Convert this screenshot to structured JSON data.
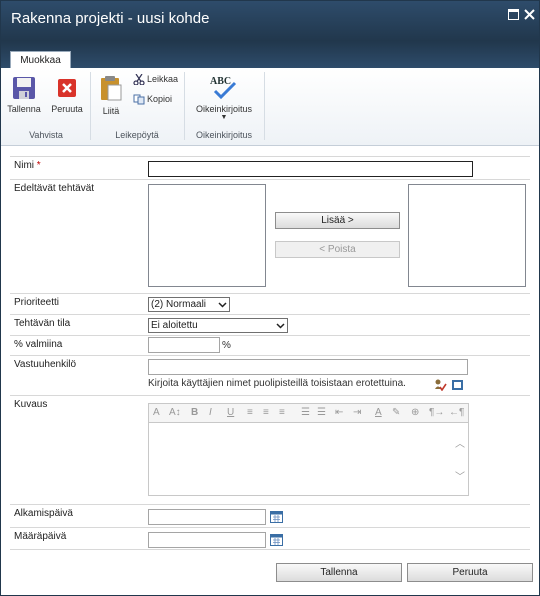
{
  "window": {
    "title": "Rakenna projekti - uusi kohde",
    "maximize_icon": "maximize-icon",
    "close_icon": "close-icon"
  },
  "ribbon": {
    "active_tab": "Muokkaa",
    "groups": {
      "commit": {
        "label": "Vahvista",
        "save": "Tallenna",
        "cancel": "Peruuta"
      },
      "clipboard": {
        "label": "Leikepöytä",
        "paste": "Liitä",
        "cut": "Leikkaa",
        "copy": "Kopioi"
      },
      "spelling": {
        "label": "Oikeinkirjoitus",
        "spelling": "Oikeinkirjoitus",
        "abc": "ABC"
      }
    }
  },
  "form": {
    "name": {
      "label": "Nimi",
      "required_mark": "*",
      "value": ""
    },
    "predecessors": {
      "label": "Edeltävät tehtävät",
      "add_button": "Lisää >",
      "remove_button": "< Poista"
    },
    "priority": {
      "label": "Prioriteetti",
      "value": "(2) Normaali"
    },
    "status": {
      "label": "Tehtävän tila",
      "value": "Ei aloitettu"
    },
    "percent": {
      "label": "% valmiina",
      "value": "",
      "unit": "%"
    },
    "assigned_to": {
      "label": "Vastuuhenkilö",
      "value": "",
      "hint": "Kirjoita käyttäjien nimet puolipisteillä toisistaan erotettuina."
    },
    "description": {
      "label": "Kuvaus",
      "value": ""
    },
    "start_date": {
      "label": "Alkamispäivä",
      "value": ""
    },
    "due_date": {
      "label": "Määräpäivä",
      "value": ""
    }
  },
  "footer": {
    "save": "Tallenna",
    "cancel": "Peruuta"
  },
  "colors": {
    "titlebar": "#21374c",
    "required": "#bf0000"
  }
}
